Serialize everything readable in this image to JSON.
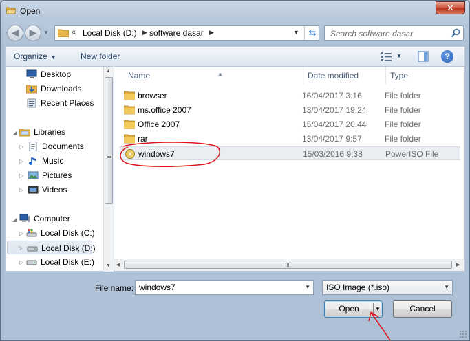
{
  "window": {
    "title": "Open",
    "close_label": "✕"
  },
  "address": {
    "overflow": "«",
    "crumbs": [
      "Local Disk (D:)",
      "software dasar"
    ],
    "search_placeholder": "Search software dasar"
  },
  "toolbar": {
    "organize": "Organize",
    "new_folder": "New folder",
    "help": "?"
  },
  "nav": {
    "favorites": [
      "Desktop",
      "Downloads",
      "Recent Places"
    ],
    "libraries": {
      "label": "Libraries",
      "items": [
        "Documents",
        "Music",
        "Pictures",
        "Videos"
      ]
    },
    "computer": {
      "label": "Computer",
      "items": [
        "Local Disk (C:)",
        "Local Disk (D:)",
        "Local Disk (E:)"
      ]
    },
    "selected": "Local Disk (D:)"
  },
  "columns": {
    "name": "Name",
    "date": "Date modified",
    "type": "Type"
  },
  "files": [
    {
      "name": "browser",
      "date": "16/04/2017 3:16",
      "type": "File folder",
      "icon": "folder-icon"
    },
    {
      "name": "ms.office 2007",
      "date": "13/04/2017 19:24",
      "type": "File folder",
      "icon": "folder-icon"
    },
    {
      "name": "Office 2007",
      "date": "15/04/2017 20:44",
      "type": "File folder",
      "icon": "folder-icon"
    },
    {
      "name": "rar",
      "date": "13/04/2017 9:57",
      "type": "File folder",
      "icon": "folder-icon"
    },
    {
      "name": "windows7",
      "date": "15/03/2016 9:38",
      "type": "PowerISO File",
      "icon": "iso-disc-icon"
    }
  ],
  "bottom": {
    "file_name_label": "File name:",
    "file_name_value": "windows7",
    "file_type": "ISO Image (*.iso)",
    "open": "Open",
    "cancel": "Cancel"
  },
  "colors": {
    "annotation": "#e0121b",
    "selection": "#dde5ef",
    "folder": "#e8b64a"
  }
}
